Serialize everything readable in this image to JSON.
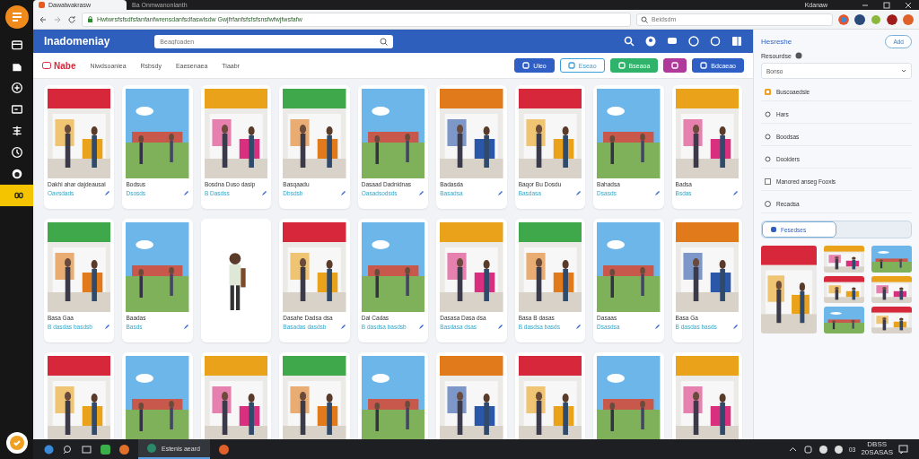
{
  "sidebar": {
    "items": [
      {
        "selected": false
      },
      {
        "selected": false
      },
      {
        "selected": false
      },
      {
        "selected": false
      },
      {
        "selected": false
      },
      {
        "selected": false
      },
      {
        "selected": false
      },
      {
        "selected": true
      }
    ]
  },
  "browser": {
    "tabs": [
      {
        "label": "Dawatwakrasw",
        "selected": true
      },
      {
        "label": "Ba Onmwanonlanth",
        "selected": false
      }
    ],
    "tray_label": "Kdanaw",
    "address": "Hwtwrsfsfsdfsfanfanfwrensdanfsdfaswlsdw Gwjfrfanfsfsfsfsnsfwfwjfwsfafw",
    "search": {
      "placeholder": "Beidsdm"
    }
  },
  "header": {
    "brand": "Inadomeniay",
    "search": {
      "placeholder": "Beaqfoaden"
    }
  },
  "subnav": {
    "logo": "Nabe",
    "links": [
      "Niwdsoaniea",
      "Rsbsdy",
      "Eaesenaea",
      "Tiaabr"
    ],
    "buttons": [
      {
        "label": "Uleo",
        "kind": "solid",
        "color": "#2f5fc4"
      },
      {
        "label": "Eseao",
        "kind": "outline",
        "color": "#3a9fd6"
      },
      {
        "label": "Bseaoa",
        "kind": "solid",
        "color": "#2fb36a"
      },
      {
        "kind": "solid",
        "color": "#b03a9a"
      },
      {
        "label": "Bdcaeao",
        "kind": "solid",
        "color": "#2f5fc4"
      }
    ]
  },
  "cards": [
    {
      "kind": "picture",
      "title": "Dakhi ahar dajdeausal",
      "link": "Oavsdads"
    },
    {
      "kind": "picture",
      "title": "Bodsus",
      "link": "Dsosds"
    },
    {
      "kind": "picture",
      "title": "Bosdna Duso dasip",
      "link": "B  Dasdss"
    },
    {
      "kind": "picture",
      "title": "Basqaadu",
      "link": "Dbsdsb"
    },
    {
      "kind": "picture",
      "title": "Dasaad Dadnidnas",
      "link": "Oasadsodsds"
    },
    {
      "kind": "picture",
      "title": "Badasda",
      "link": "Basadsa"
    },
    {
      "kind": "picture",
      "title": "Baqor Bu Dosdu",
      "link": "Basdasa"
    },
    {
      "kind": "picture",
      "title": "Bahadsa",
      "link": "Dsasds"
    },
    {
      "kind": "picture",
      "title": "Badsa",
      "link": "Bsdas"
    },
    {
      "kind": "picture",
      "title": "Basa Gaa",
      "link": "B dasdas basdsb"
    },
    {
      "kind": "picture",
      "title": "Baadas",
      "link": "Basds"
    },
    {
      "kind": "figure"
    },
    {
      "kind": "picture",
      "title": "Dasahe Dadsa dsa",
      "link": "Basadas dasdsb"
    },
    {
      "kind": "picture",
      "title": "Dal Cadas",
      "link": "B dasdsa basdsb"
    },
    {
      "kind": "picture",
      "title": "Dasasa Dasa dsa",
      "link": "Basdasa dsas"
    },
    {
      "kind": "picture",
      "title": "Basa B dasas",
      "link": "B dasdsa basds"
    },
    {
      "kind": "picture",
      "title": "Dasaas",
      "link": "Dsasdsa"
    },
    {
      "kind": "picture",
      "title": "Basa Ga",
      "link": "B dasdas basds"
    },
    {
      "kind": "picture"
    },
    {
      "kind": "picture"
    },
    {
      "kind": "picture"
    },
    {
      "kind": "picture"
    },
    {
      "kind": "picture"
    },
    {
      "kind": "picture"
    },
    {
      "kind": "picture"
    },
    {
      "kind": "picture"
    },
    {
      "kind": "picture"
    }
  ],
  "panel": {
    "title": "Hesreshe",
    "add_button": "Add",
    "subtitle": "Resourdse",
    "dropdown": "Bonso",
    "items": [
      {
        "kind": "tag",
        "label": "Buscoaedsle"
      },
      {
        "kind": "glyph",
        "label": "Hars"
      },
      {
        "kind": "glyph",
        "label": "Boodsas"
      },
      {
        "kind": "glyph",
        "label": "Dooiders"
      },
      {
        "kind": "checkbox",
        "checked": false,
        "label": "Manored anseg Fooxls"
      },
      {
        "kind": "circle",
        "label": "Recadsa"
      }
    ],
    "tabs": [
      {
        "label": "Fesedses",
        "selected": true
      }
    ],
    "thumbnails": [
      {
        "kind": "picture"
      },
      {
        "kind": "picture"
      },
      {
        "kind": "picture"
      },
      {
        "kind": "picture"
      },
      {
        "kind": "picture"
      },
      {
        "kind": "picture"
      },
      {
        "kind": "picture"
      }
    ]
  },
  "taskbar": {
    "app": "Estenis aeard",
    "tray": "03",
    "time": "DBSS",
    "date": "20SASAS"
  }
}
